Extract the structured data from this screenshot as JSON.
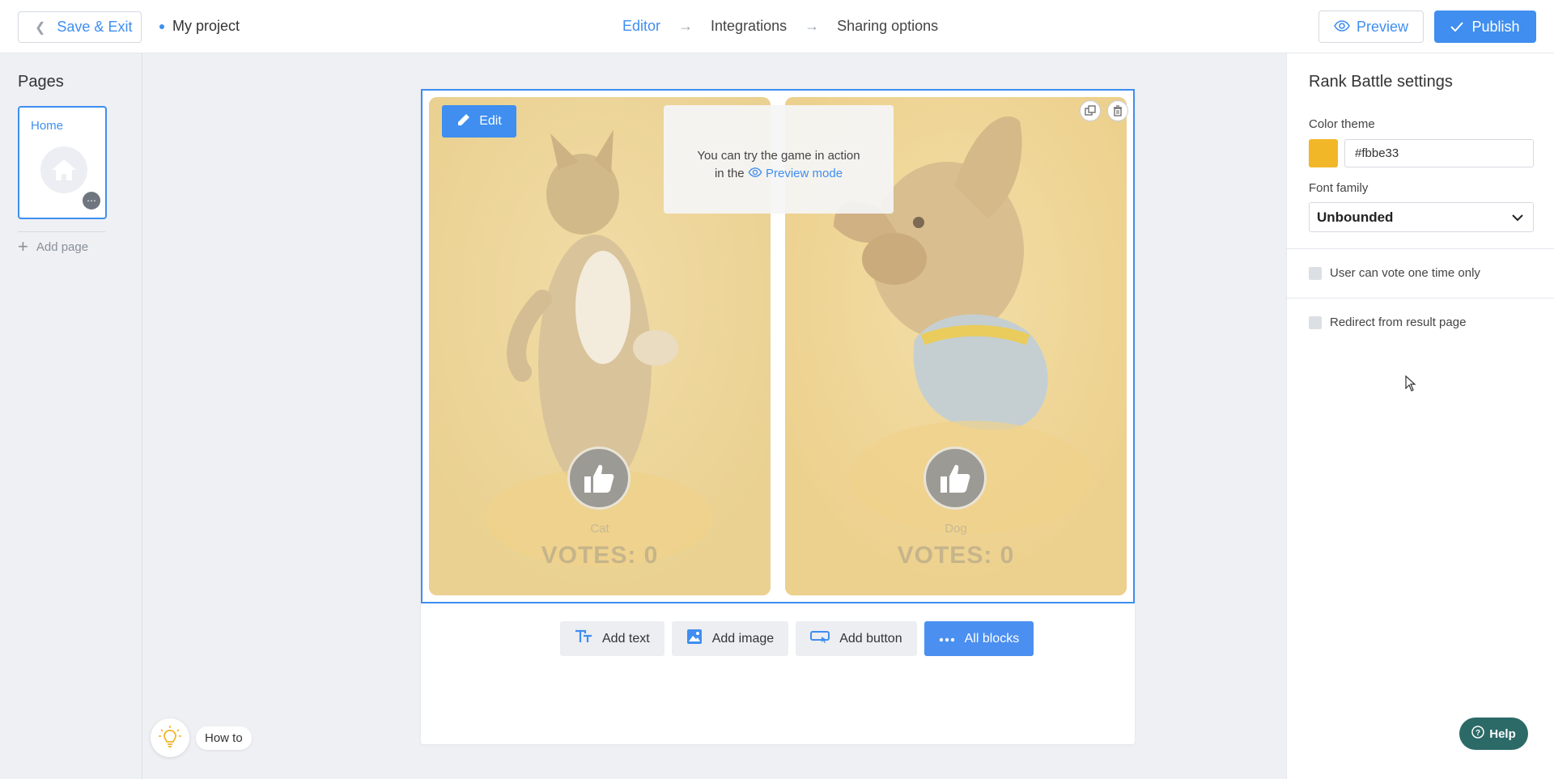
{
  "topbar": {
    "save_exit": "Save & Exit",
    "project_name": "My project",
    "steps": [
      "Editor",
      "Integrations",
      "Sharing options"
    ],
    "preview": "Preview",
    "publish": "Publish"
  },
  "pages_panel": {
    "title": "Pages",
    "pages": [
      {
        "label": "Home"
      }
    ],
    "add_page": "Add page"
  },
  "howto": "How to",
  "editor": {
    "edit_button": "Edit",
    "tip_line1": "You can try the game in action",
    "tip_line2_prefix": "in the",
    "tip_link": "Preview mode",
    "items": [
      {
        "name": "Cat",
        "votes_label": "VOTES:",
        "votes": "0"
      },
      {
        "name": "Dog",
        "votes_label": "VOTES:",
        "votes": "0"
      }
    ]
  },
  "add_blocks": {
    "text": "Add text",
    "image": "Add image",
    "button": "Add button",
    "all": "All blocks"
  },
  "settings": {
    "title": "Rank Battle settings",
    "color_theme_label": "Color theme",
    "color_value": "#fbbe33",
    "font_family_label": "Font family",
    "font_family_value": "Unbounded",
    "vote_once": "User can vote one time only",
    "redirect": "Redirect from result page"
  },
  "help": "Help",
  "colors": {
    "accent": "#3f8ef0",
    "theme_swatch": "#f2b728",
    "help_bg": "#2b6a67"
  }
}
